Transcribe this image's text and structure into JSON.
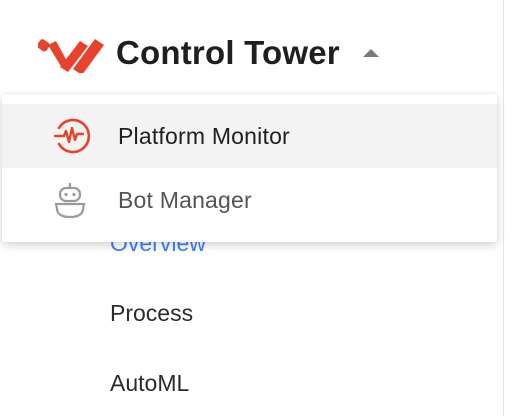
{
  "header": {
    "title": "Control Tower",
    "logo_icon": "control-tower-logo",
    "toggle_icon": "caret-up-icon",
    "brand_color": "#e8412c"
  },
  "dropdown": {
    "items": [
      {
        "label": "Platform Monitor",
        "icon": "platform-monitor-icon",
        "highlighted": true
      },
      {
        "label": "Bot Manager",
        "icon": "robot-icon",
        "highlighted": false
      }
    ]
  },
  "subnav": {
    "items": [
      {
        "label": "Overview",
        "active": true
      },
      {
        "label": "Process",
        "active": false
      },
      {
        "label": "AutoML",
        "active": false
      }
    ],
    "active_color": "#3b82f6"
  }
}
